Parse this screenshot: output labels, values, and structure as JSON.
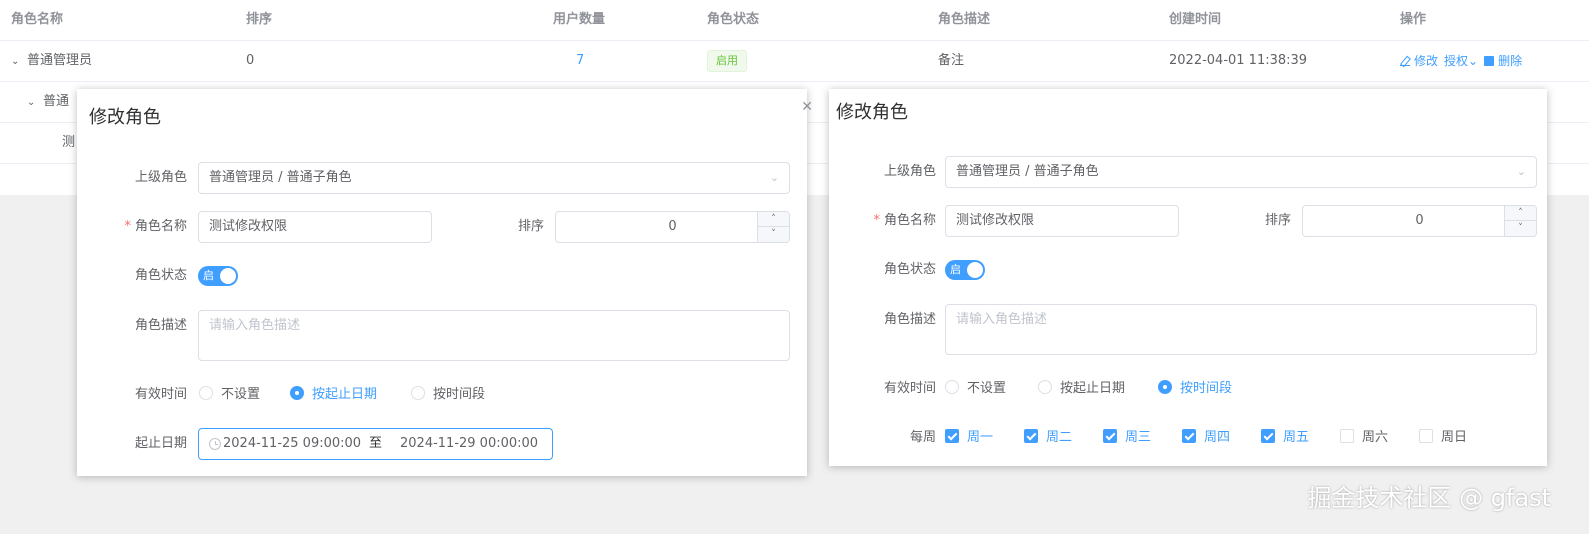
{
  "table": {
    "headers": [
      "角色名称",
      "排序",
      "用户数量",
      "角色状态",
      "角色描述",
      "创建时间",
      "操作"
    ],
    "row1": {
      "name": "普通管理员",
      "sort": "0",
      "users": "7",
      "status": "启用",
      "desc": "备注",
      "created": "2022-04-01 11:38:39",
      "ops": {
        "edit": "修改",
        "grant": "授权",
        "delete": "删除"
      }
    },
    "row2_name_partial": "普通",
    "row3_name_partial": "测"
  },
  "dialog_left": {
    "title": "修改角色",
    "parent_label": "上级角色",
    "parent_value": "普通管理员 / 普通子角色",
    "name_label": "角色名称",
    "name_value": "测试修改权限",
    "sort_label": "排序",
    "sort_value": "0",
    "status_label": "角色状态",
    "switch_text": "启",
    "desc_label": "角色描述",
    "desc_placeholder": "请输入角色描述",
    "valid_label": "有效时间",
    "radio_options": [
      "不设置",
      "按起止日期",
      "按时间段"
    ],
    "radio_selected": 1,
    "date_label": "起止日期",
    "date_start": "2024-11-25 09:00:00",
    "date_sep": "至",
    "date_end": "2024-11-29 00:00:00"
  },
  "dialog_right": {
    "title": "修改角色",
    "parent_label": "上级角色",
    "parent_value": "普通管理员 / 普通子角色",
    "name_label": "角色名称",
    "name_value": "测试修改权限",
    "sort_label": "排序",
    "sort_value": "0",
    "status_label": "角色状态",
    "switch_text": "启",
    "desc_label": "角色描述",
    "desc_placeholder": "请输入角色描述",
    "valid_label": "有效时间",
    "radio_options": [
      "不设置",
      "按起止日期",
      "按时间段"
    ],
    "radio_selected": 2,
    "week_label": "每周",
    "weekdays": [
      {
        "label": "周一",
        "checked": true
      },
      {
        "label": "周二",
        "checked": true
      },
      {
        "label": "周三",
        "checked": true
      },
      {
        "label": "周四",
        "checked": true
      },
      {
        "label": "周五",
        "checked": true
      },
      {
        "label": "周六",
        "checked": false
      },
      {
        "label": "周日",
        "checked": false
      }
    ]
  },
  "watermark": "掘金技术社区 @ gfast",
  "colors": {
    "primary": "#409eff",
    "success": "#67c23a",
    "danger": "#f56c6c"
  }
}
